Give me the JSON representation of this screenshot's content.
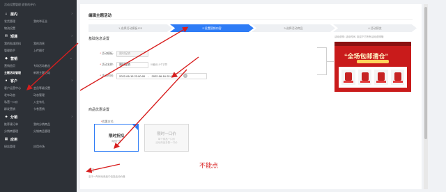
{
  "sidebar": {
    "top_links": "活动设置管理  收到的评价",
    "sections": [
      {
        "title": "屋内",
        "icon": "home-icon",
        "rows": [
          [
            "发货管理",
            "我的举证业"
          ],
          [
            "物流设置",
            ""
          ]
        ]
      },
      {
        "title": "短通",
        "icon": "message-icon",
        "rows": [
          [
            "我的私域资料",
            "我的消息"
          ],
          [
            "管理助手",
            "上传图片"
          ]
        ]
      },
      {
        "title": "营销",
        "icon": "marketing-icon",
        "rows": [
          [
            "营销首页",
            "专场活动着丝"
          ],
          [
            "主题活动管理",
            "新建主题活动"
          ]
        ]
      },
      {
        "title": "客户",
        "icon": "user-icon",
        "rows": [
          [
            "客户运营中心",
            "会员等级设置"
          ],
          [
            "发布动态",
            "动态管理"
          ],
          [
            "私营一口价",
            "入会有礼"
          ],
          [
            "群发营销",
            "卡卷营销"
          ]
        ]
      },
      {
        "title": "分销",
        "icon": "share-icon",
        "rows": [
          [
            "推荐建订单",
            "我的分销商品"
          ],
          [
            "分销商管理",
            "分销商品管理"
          ]
        ]
      },
      {
        "title": "应用",
        "icon": "app-icon",
        "rows": [
          [
            "绿店管理",
            "应用市场"
          ]
        ]
      }
    ],
    "active_item": "主题活动管理"
  },
  "main": {
    "title": "编辑主题活动",
    "steps": [
      "1.选择活动模板123",
      "2.设置营销内容",
      "3.选择活动商品",
      "4.活动预览"
    ],
    "current_step": 1,
    "base_section_title": "基础信息设置",
    "fields": {
      "template_label": "活动模板:",
      "template_value": "限时促销",
      "name_label": "活动名称:",
      "name_value": "限时促销",
      "name_hint": "0/最长10个字符",
      "time_label": "活动时间:",
      "time_start": "2022-06-15 22:00:00",
      "time_sep": "-",
      "time_end": "2022-06-16 02:00:00"
    },
    "preview_label": "活动说明: 活动时间, 欢迎下方所有活动说明哦",
    "preview_banner": "“全场包邮清仓”",
    "discount_section_title": "商品优惠设置",
    "discount_label": "优惠方式:",
    "options": [
      {
        "title": "限时折扣",
        "desc": "商品打折",
        "selected": true
      },
      {
        "title": "限时一口价",
        "desc": "单个商品一口价\n活动商品多数一口价",
        "selected": false
      }
    ],
    "bottom_note": "至于一所惊动商品中包括活动价格",
    "annotation": "不能点"
  },
  "colors": {
    "accent": "#2e7cf6",
    "sidebar_bg": "#2d3137",
    "annotation_red": "#d81e1e"
  }
}
